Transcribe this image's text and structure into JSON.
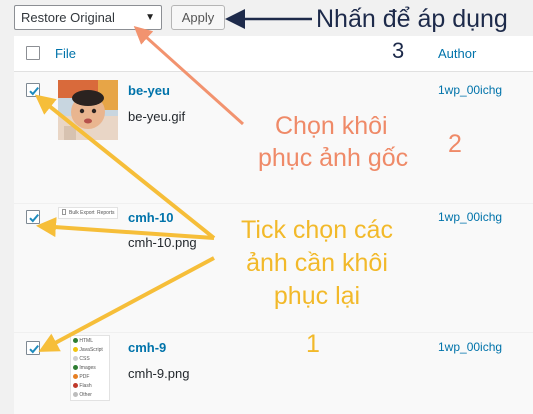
{
  "toolbar": {
    "bulk_action_value": "Restore Original",
    "apply_label": "Apply"
  },
  "table": {
    "columns": {
      "file": "File",
      "author": "Author"
    },
    "rows": [
      {
        "title": "be-yeu",
        "filename": "be-yeu.gif",
        "author": "1wp_00ichg",
        "checked": true
      },
      {
        "title": "cmh-10",
        "filename": "cmh-10.png",
        "author": "1wp_00ichg",
        "checked": true
      },
      {
        "title": "cmh-9",
        "filename": "cmh-9.png",
        "author": "1wp_00ichg",
        "checked": true
      }
    ]
  },
  "thumbnails": {
    "cmh10_tabs": [
      "Bulk Export",
      "Reports"
    ],
    "cmh9_legend": [
      {
        "label": "HTML",
        "color": "#2e7d32"
      },
      {
        "label": "JavaScript",
        "color": "#f1c40f"
      },
      {
        "label": "CSS",
        "color": "#cfcfcf"
      },
      {
        "label": "Images",
        "color": "#2e7d32"
      },
      {
        "label": "PDF",
        "color": "#e67e22"
      },
      {
        "label": "Flash",
        "color": "#c0392b"
      },
      {
        "label": "Other",
        "color": "#bdbdbd"
      }
    ]
  },
  "annotations": {
    "apply_hint": "Nhấn để áp dụng",
    "step3": "3",
    "choose_restore_line1": "Chọn khôi",
    "choose_restore_line2": "phục ảnh gốc",
    "step2": "2",
    "tick_line1": "Tick chọn các",
    "tick_line2": "ảnh cần khôi",
    "tick_line3": "phục lại",
    "step1": "1"
  },
  "colors": {
    "arrow_orange": "#f2936f",
    "arrow_yellow": "#f6be39",
    "arrow_dark": "#1d2a4a",
    "link_blue": "#0073aa"
  }
}
